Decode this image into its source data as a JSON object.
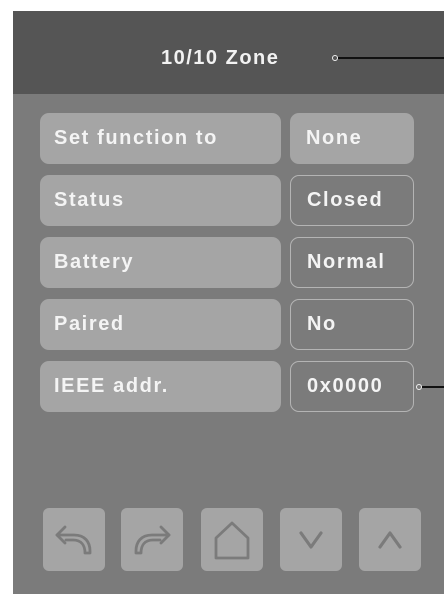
{
  "header": {
    "title": "10/10 Zone"
  },
  "rows": [
    {
      "label": "Set function to",
      "value": "None",
      "value_style": "filled"
    },
    {
      "label": "Status",
      "value": "Closed",
      "value_style": "outlined"
    },
    {
      "label": "Battery",
      "value": "Normal",
      "value_style": "outlined"
    },
    {
      "label": "Paired",
      "value": "No",
      "value_style": "outlined"
    },
    {
      "label": "IEEE addr.",
      "value": "0x0000",
      "value_style": "outlined"
    }
  ],
  "nav_buttons": [
    {
      "icon": "undo-icon"
    },
    {
      "icon": "redo-icon"
    },
    {
      "icon": "home-icon"
    },
    {
      "icon": "chevron-down-icon"
    },
    {
      "icon": "chevron-up-icon"
    }
  ],
  "colors": {
    "screen_background": "#7b7b7b",
    "header_background": "#555555",
    "button_fill": "#a5a5a5",
    "button_outline": "#b4b4b4",
    "text": "#f4f4f4",
    "icon_stroke": "#7b7b7b",
    "callout_line": "#111111"
  }
}
